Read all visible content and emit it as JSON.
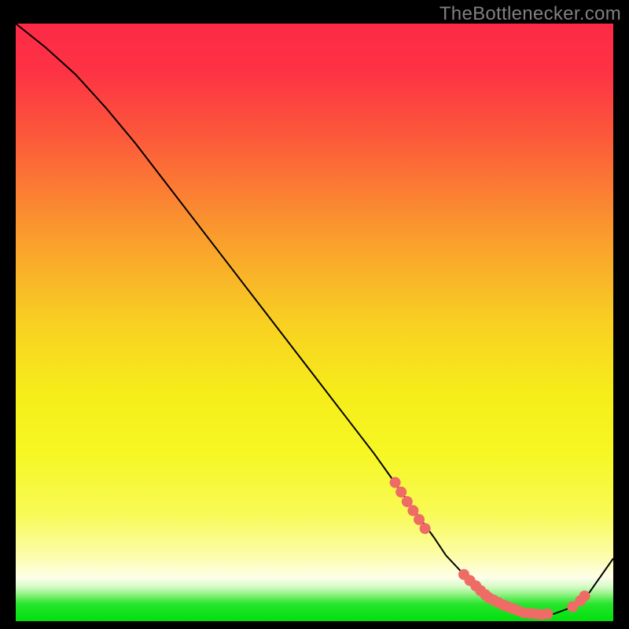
{
  "attribution": "TheBottlenecker.com",
  "chart_data": {
    "type": "line",
    "title": "",
    "xlabel": "",
    "ylabel": "",
    "xlim": [
      0,
      100
    ],
    "ylim": [
      0,
      100
    ],
    "background_gradient": {
      "stops": [
        {
          "offset": 0.0,
          "color": "#fd2a46"
        },
        {
          "offset": 0.08,
          "color": "#fd3244"
        },
        {
          "offset": 0.2,
          "color": "#fc5d3a"
        },
        {
          "offset": 0.35,
          "color": "#fa9a2e"
        },
        {
          "offset": 0.5,
          "color": "#f8d022"
        },
        {
          "offset": 0.62,
          "color": "#f6ed1a"
        },
        {
          "offset": 0.72,
          "color": "#f6f724"
        },
        {
          "offset": 0.82,
          "color": "#f8fa56"
        },
        {
          "offset": 0.89,
          "color": "#fcfda8"
        },
        {
          "offset": 0.927,
          "color": "#fefeea"
        },
        {
          "offset": 0.942,
          "color": "#d6fbc8"
        },
        {
          "offset": 0.953,
          "color": "#9ef490"
        },
        {
          "offset": 0.963,
          "color": "#5bec56"
        },
        {
          "offset": 0.972,
          "color": "#25e52a"
        },
        {
          "offset": 1.0,
          "color": "#00e00d"
        }
      ]
    },
    "series": [
      {
        "name": "bottleneck-curve",
        "color": "#000000",
        "stroke_width": 2,
        "x": [
          0,
          5,
          10,
          15,
          20,
          25,
          30,
          35,
          40,
          45,
          50,
          55,
          60,
          63,
          66,
          70,
          72,
          75,
          78,
          80,
          83,
          85,
          88,
          90,
          93,
          96,
          100
        ],
        "y": [
          100,
          96,
          91.5,
          86,
          80,
          73.5,
          67,
          60.5,
          54,
          47.5,
          41,
          34.5,
          28,
          23.8,
          19.5,
          14,
          11,
          7.8,
          5,
          3.4,
          2,
          1.4,
          1.1,
          1.2,
          2.3,
          4.8,
          10.5
        ]
      }
    ],
    "markers": {
      "name": "salmon-dots",
      "color": "#ee6b66",
      "radius": 7,
      "points": [
        {
          "x": 63.5,
          "y": 23.2
        },
        {
          "x": 64.5,
          "y": 21.6
        },
        {
          "x": 65.5,
          "y": 20.0
        },
        {
          "x": 66.5,
          "y": 18.5
        },
        {
          "x": 67.5,
          "y": 17.0
        },
        {
          "x": 68.5,
          "y": 15.5
        },
        {
          "x": 75.0,
          "y": 7.8
        },
        {
          "x": 76.0,
          "y": 6.8
        },
        {
          "x": 77.0,
          "y": 5.9
        },
        {
          "x": 77.8,
          "y": 5.1
        },
        {
          "x": 78.6,
          "y": 4.4
        },
        {
          "x": 79.2,
          "y": 3.9
        },
        {
          "x": 80.0,
          "y": 3.5
        },
        {
          "x": 80.8,
          "y": 3.1
        },
        {
          "x": 81.6,
          "y": 2.7
        },
        {
          "x": 82.4,
          "y": 2.4
        },
        {
          "x": 83.2,
          "y": 2.1
        },
        {
          "x": 84.0,
          "y": 1.8
        },
        {
          "x": 85.0,
          "y": 1.4
        },
        {
          "x": 86.0,
          "y": 1.3
        },
        {
          "x": 87.0,
          "y": 1.2
        },
        {
          "x": 88.0,
          "y": 1.1
        },
        {
          "x": 89.0,
          "y": 1.2
        },
        {
          "x": 93.2,
          "y": 2.4
        },
        {
          "x": 94.5,
          "y": 3.4
        },
        {
          "x": 95.2,
          "y": 4.2
        }
      ]
    }
  }
}
